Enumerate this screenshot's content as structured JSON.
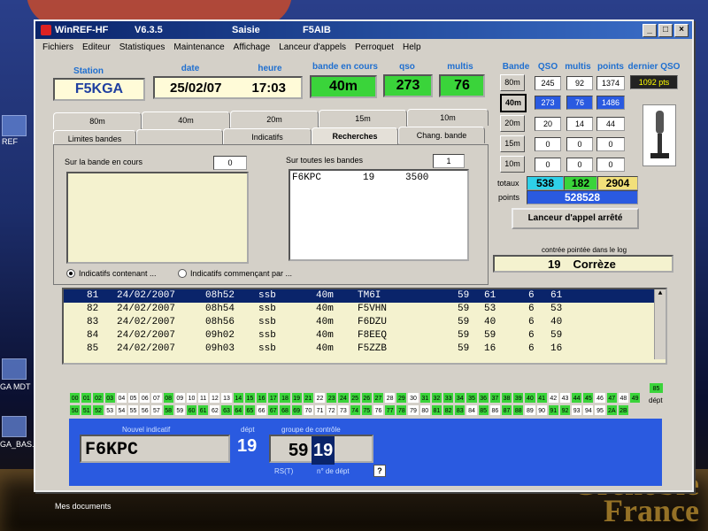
{
  "title_bar": {
    "app": "WinREF-HF",
    "version": "V6.3.5",
    "mode": "Saisie",
    "operator": "F5AIB",
    "min": "_",
    "max": "□",
    "close": "×"
  },
  "menu": [
    "Fichiers",
    "Editeur",
    "Statistiques",
    "Maintenance",
    "Affichage",
    "Lanceur d'appels",
    "Perroquet",
    "Help"
  ],
  "header": {
    "station_label": "Station",
    "station": "F5KGA",
    "date_label": "date",
    "date": "25/02/07",
    "time_label": "heure",
    "time": "17:03",
    "band_label": "bande en cours",
    "band": "40m",
    "qso_label": "qso",
    "qso": "273",
    "multis_label": "multis",
    "multis": "76"
  },
  "band_tabs": [
    "80m",
    "40m",
    "20m",
    "15m",
    "10m"
  ],
  "sub_tabs": [
    "Limites bandes",
    "",
    "Indicatifs",
    "Recherches",
    "Chang. bande"
  ],
  "search": {
    "band_label": "Sur la bande en cours",
    "band_count": "0",
    "all_label": "Sur toutes les bandes",
    "all_count": "1",
    "result_call": "F6KPC",
    "result_dept": "19",
    "result_freq": "3500",
    "radio1": "Indicatifs contenant ...",
    "radio2": "Indicatifs commençant par ..."
  },
  "stats": {
    "headers": {
      "band": "Bande",
      "qso": "QSO",
      "multis": "multis",
      "points": "points",
      "last": "dernier QSO"
    },
    "last_qso": "1092 pts",
    "rows": [
      {
        "band": "80m",
        "qso": "245",
        "multis": "92",
        "points": "1374"
      },
      {
        "band": "40m",
        "qso": "273",
        "multis": "76",
        "points": "1486"
      },
      {
        "band": "20m",
        "qso": "20",
        "multis": "14",
        "points": "44"
      },
      {
        "band": "15m",
        "qso": "0",
        "multis": "0",
        "points": "0"
      },
      {
        "band": "10m",
        "qso": "0",
        "multis": "0",
        "points": "0"
      }
    ],
    "totals_label": "totaux",
    "total_qso": "538",
    "total_multis": "182",
    "total_points": "2904",
    "points_label": "points",
    "score": "528528",
    "caller_button": "Lanceur d'appel arrêté",
    "dept_label": "contrée pointée dans le log",
    "dept_num": "19",
    "dept_name": "Corrèze"
  },
  "log": [
    {
      "n": "81",
      "date": "24/02/2007",
      "time": "08h52",
      "mode": "ssb",
      "band": "40m",
      "call": "TM6I",
      "rst_s": "59",
      "rst_r": "61",
      "x": "6",
      "dept": "61"
    },
    {
      "n": "82",
      "date": "24/02/2007",
      "time": "08h54",
      "mode": "ssb",
      "band": "40m",
      "call": "F5VHN",
      "rst_s": "59",
      "rst_r": "53",
      "x": "6",
      "dept": "53"
    },
    {
      "n": "83",
      "date": "24/02/2007",
      "time": "08h56",
      "mode": "ssb",
      "band": "40m",
      "call": "F6DZU",
      "rst_s": "59",
      "rst_r": "40",
      "x": "6",
      "dept": "40"
    },
    {
      "n": "84",
      "date": "24/02/2007",
      "time": "09h02",
      "mode": "ssb",
      "band": "40m",
      "call": "F8EEQ",
      "rst_s": "59",
      "rst_r": "59",
      "x": "6",
      "dept": "59"
    },
    {
      "n": "85",
      "date": "24/02/2007",
      "time": "09h03",
      "mode": "ssb",
      "band": "40m",
      "call": "F5ZZB",
      "rst_s": "59",
      "rst_r": "16",
      "x": "6",
      "dept": "16"
    }
  ],
  "dept_grid": {
    "row1": [
      "00",
      "01",
      "02",
      "03",
      "04",
      "05",
      "06",
      "07",
      "08",
      "09",
      "10",
      "11",
      "12",
      "13",
      "14",
      "15",
      "16",
      "17",
      "18",
      "19",
      "21",
      "22",
      "23",
      "24",
      "25",
      "26",
      "27",
      "28",
      "29",
      "30",
      "31",
      "32",
      "33",
      "34",
      "35",
      "36",
      "37",
      "38",
      "39",
      "40",
      "41",
      "42",
      "43",
      "44",
      "45",
      "46",
      "47",
      "48",
      "49"
    ],
    "row1_white": [
      "04",
      "05",
      "06",
      "07",
      "09",
      "10",
      "11",
      "12",
      "13",
      "20",
      "22",
      "28",
      "30",
      "42",
      "43",
      "46",
      "48"
    ],
    "row2": [
      "50",
      "51",
      "52",
      "53",
      "54",
      "55",
      "56",
      "57",
      "58",
      "59",
      "60",
      "61",
      "62",
      "63",
      "64",
      "65",
      "66",
      "67",
      "68",
      "69",
      "70",
      "71",
      "72",
      "73",
      "74",
      "75",
      "76",
      "77",
      "78",
      "79",
      "80",
      "81",
      "82",
      "83",
      "84",
      "85",
      "86",
      "87",
      "88",
      "89",
      "90",
      "91",
      "92",
      "93",
      "94",
      "95",
      "2A",
      "2B"
    ],
    "row2_white": [
      "53",
      "54",
      "55",
      "56",
      "57",
      "59",
      "62",
      "66",
      "70",
      "71",
      "72",
      "73",
      "76",
      "79",
      "80",
      "84",
      "86",
      "89",
      "90",
      "93",
      "94",
      "95"
    ],
    "extra": "85",
    "extra_label": "dépt"
  },
  "entry": {
    "new_call_label": "Nouvel indicatif",
    "new_call": "F6KPC",
    "dept_label": "dépt",
    "dept": "19",
    "control_label": "groupe de contrôle",
    "rst": "59",
    "rst_dept": "19",
    "rst_label": "RS(T)",
    "ndept_label": "n° de dépt",
    "help": "?"
  },
  "desktop": {
    "ref_label": "REF",
    "icon2": "GA MDT",
    "icon3": "GA_BAS...",
    "icon4": "Mes documents",
    "wallpaper_text": "Grenoble\nFrance"
  }
}
